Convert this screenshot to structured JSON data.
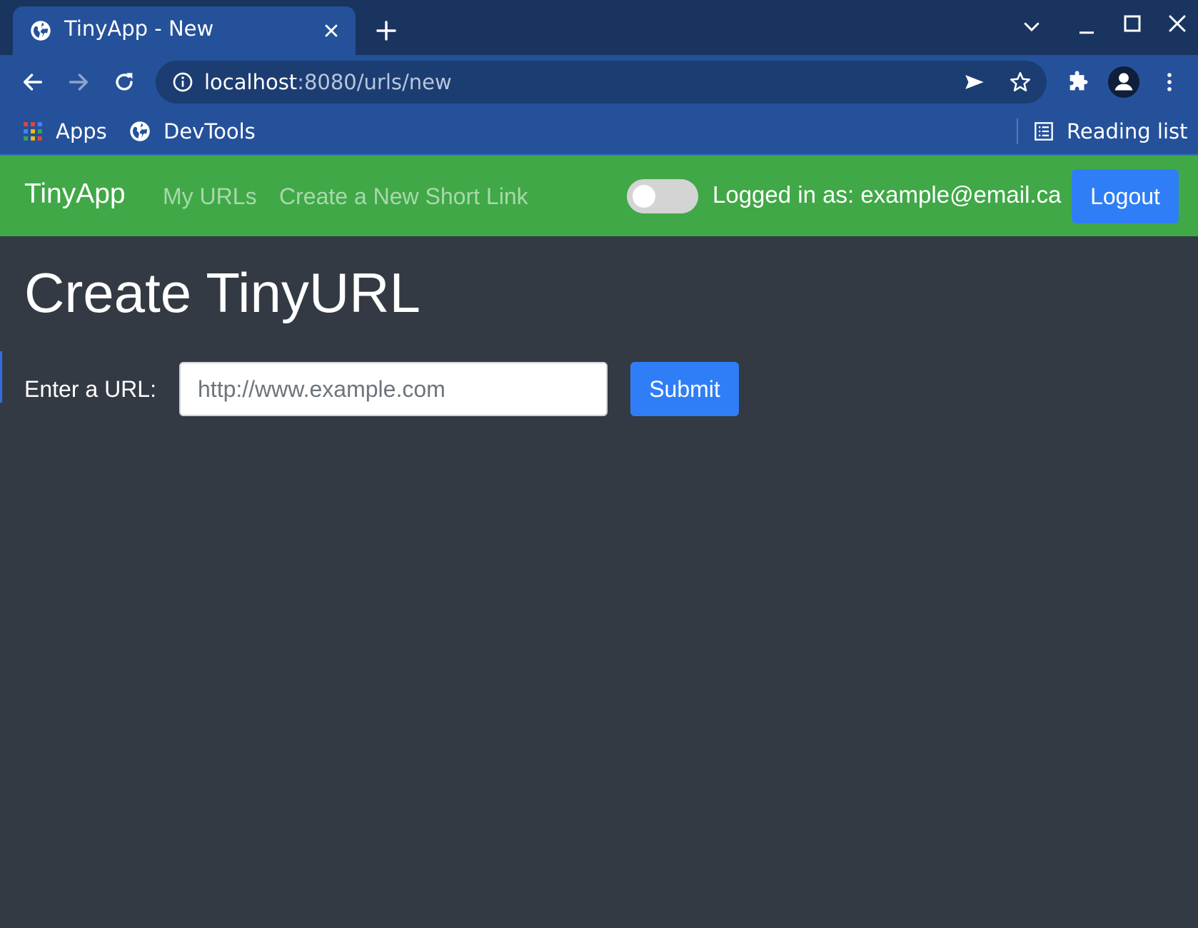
{
  "browser": {
    "tab": {
      "title": "TinyApp - New",
      "favicon": "globe-icon"
    },
    "omnibox": {
      "url_host": "localhost",
      "url_path": ":8080/urls/new"
    },
    "bookmarks": [
      {
        "label": "Apps",
        "icon": "apps-grid-icon"
      },
      {
        "label": "DevTools",
        "icon": "globe-icon"
      }
    ],
    "reading_list_label": "Reading list",
    "colors": {
      "tabstrip": "#19345f",
      "toolbar": "#24519a",
      "omnibox": "#1b3d72"
    }
  },
  "navbar": {
    "brand": "TinyApp",
    "links": [
      "My URLs",
      "Create a New Short Link"
    ],
    "dark_mode_toggle_on": false,
    "logged_in_text": "Logged in as: example@email.ca",
    "logout_label": "Logout",
    "color": "#40a847"
  },
  "main": {
    "title": "Create TinyURL",
    "form": {
      "label": "Enter a URL:",
      "placeholder": "http://www.example.com",
      "value": "",
      "submit_label": "Submit"
    },
    "background": "#343a43",
    "accent": "#2f7ef7"
  }
}
